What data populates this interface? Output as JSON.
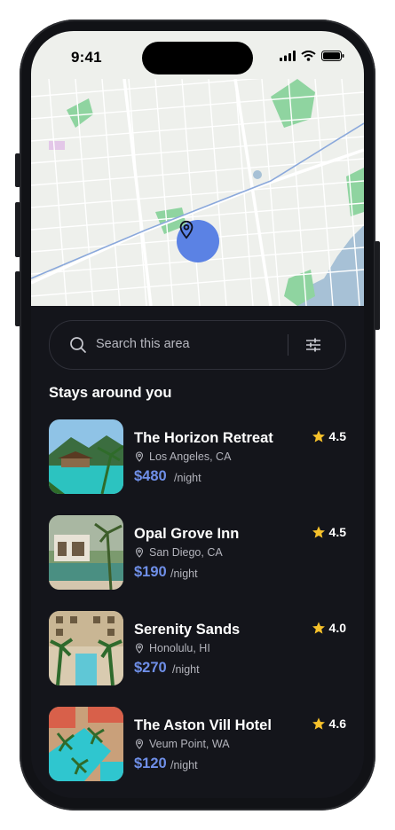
{
  "status": {
    "time": "9:41"
  },
  "search": {
    "placeholder": "Search this area"
  },
  "section_title": "Stays around you",
  "currency_suffix": "/night",
  "colors": {
    "accent": "#6f8fe8",
    "pin": "#5b82e4",
    "star": "#f6c12b",
    "background": "#14151b"
  },
  "stays": [
    {
      "name": "The Horizon Retreat",
      "location": "Los Angeles, CA",
      "price": "$480",
      "rating": "4.5"
    },
    {
      "name": "Opal Grove Inn",
      "location": "San Diego, CA",
      "price": "$190",
      "rating": "4.5"
    },
    {
      "name": "Serenity Sands",
      "location": "Honolulu, HI",
      "price": "$270",
      "rating": "4.0"
    },
    {
      "name": "The Aston Vill Hotel",
      "location": "Veum Point, WA",
      "price": "$120",
      "rating": "4.6"
    }
  ]
}
